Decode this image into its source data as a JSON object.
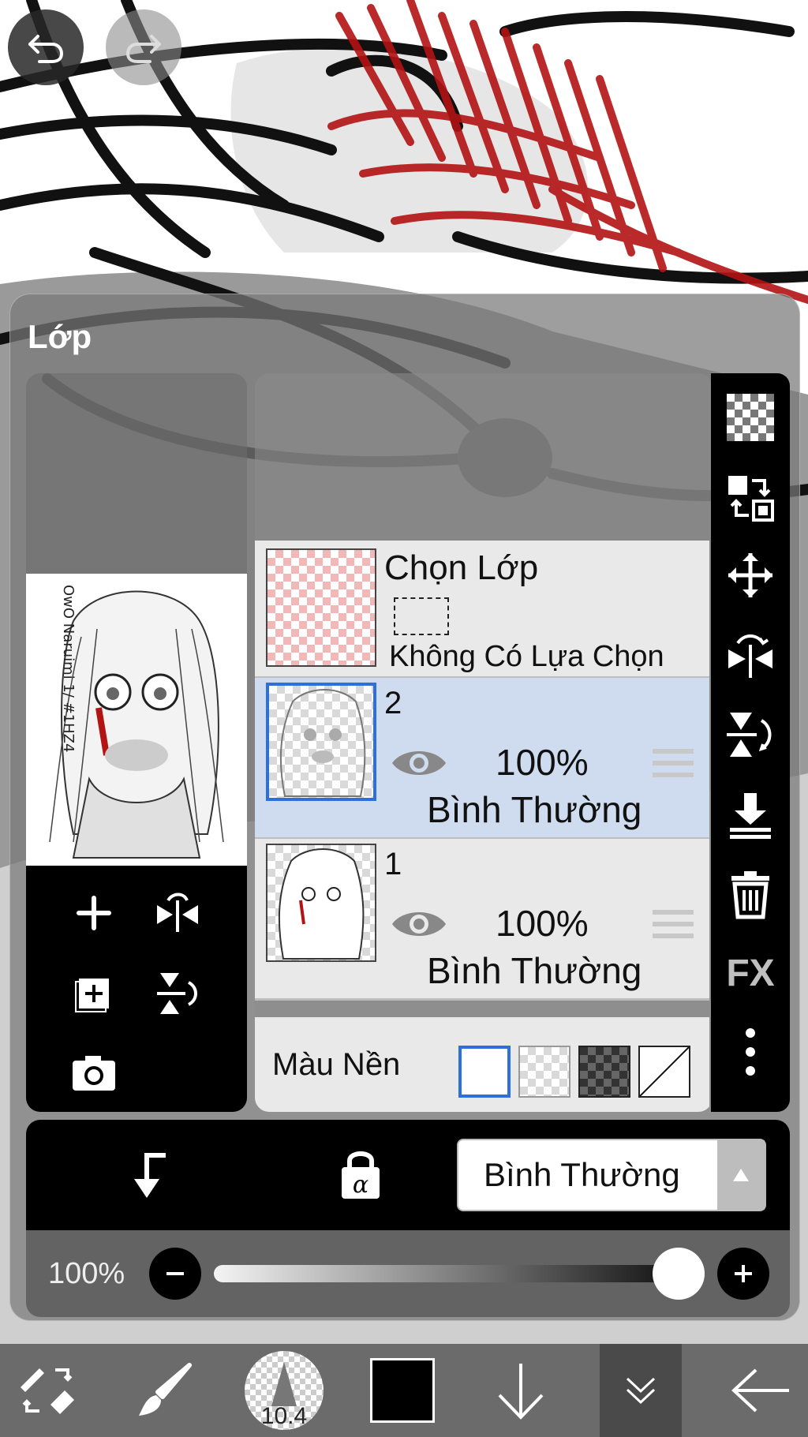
{
  "header": {
    "undo_icon": "undo-arrow-icon",
    "redo_icon": "redo-arrow-icon"
  },
  "layer_panel": {
    "title": "Lớp",
    "preview": {
      "signature_text": "OwO Naruimi 1/ #1HZ4"
    },
    "selection_layer": {
      "title": "Chọn Lớp",
      "status": "Không Có Lựa Chọn"
    },
    "layers": [
      {
        "number": "2",
        "opacity": "100%",
        "blend": "Bình Thường",
        "visible": true,
        "selected": true
      },
      {
        "number": "1",
        "opacity": "100%",
        "blend": "Bình Thường",
        "visible": true,
        "selected": false
      }
    ],
    "background": {
      "label": "Màu Nền",
      "options": [
        "white",
        "transparent-light",
        "transparent-dark",
        "none"
      ],
      "selected": "white"
    },
    "right_tools": [
      "checker-icon",
      "swap-layers-icon",
      "move-icon",
      "flip-horizontal-icon",
      "flip-vertical-icon",
      "merge-down-icon",
      "trash-icon",
      "fx",
      "more-icon"
    ],
    "fx_label": "FX",
    "blend_mode": "Bình Thường",
    "opacity_label": "100%",
    "opacity_value": 1.0
  },
  "bottom_toolbar": {
    "brush_size": "10.4",
    "color": "#000000"
  },
  "colors": {
    "accent_blue": "#2f6fdb",
    "selected_row": "#cfdcef",
    "accent_red": "#c81e1e"
  }
}
